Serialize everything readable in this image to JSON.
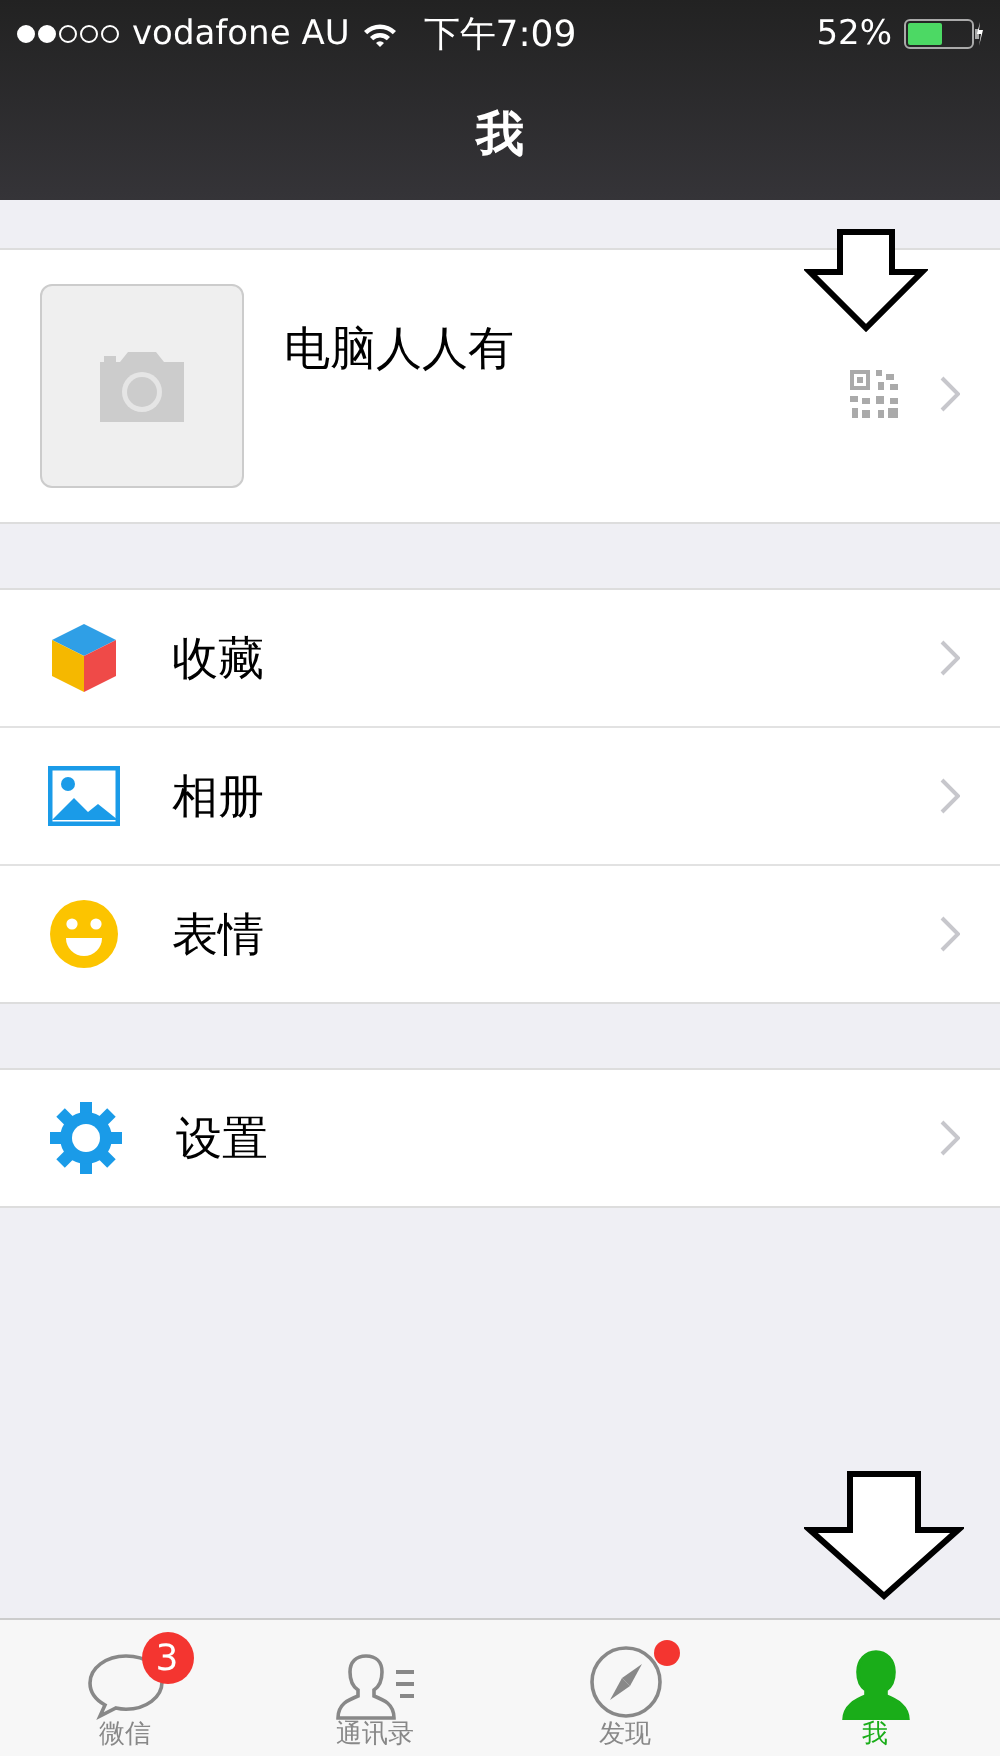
{
  "status_bar": {
    "carrier": "vodafone AU",
    "time": "下午7:09",
    "battery": "52%"
  },
  "nav": {
    "title": "我"
  },
  "profile": {
    "name": "电脑人人有"
  },
  "groups": [
    [
      {
        "kind": "cube",
        "label": "收藏"
      },
      {
        "kind": "photo",
        "label": "相册"
      },
      {
        "kind": "smile",
        "label": "表情"
      }
    ],
    [
      {
        "kind": "gear",
        "label": "设置"
      }
    ]
  ],
  "tabs": [
    {
      "kind": "chat",
      "label": "微信",
      "badge": "3",
      "dot": false,
      "selected": false
    },
    {
      "kind": "contacts",
      "label": "通讯录",
      "dot": false,
      "selected": false
    },
    {
      "kind": "compass",
      "label": "发现",
      "dot": true,
      "selected": false
    },
    {
      "kind": "person",
      "label": "我",
      "dot": false,
      "selected": true
    }
  ]
}
